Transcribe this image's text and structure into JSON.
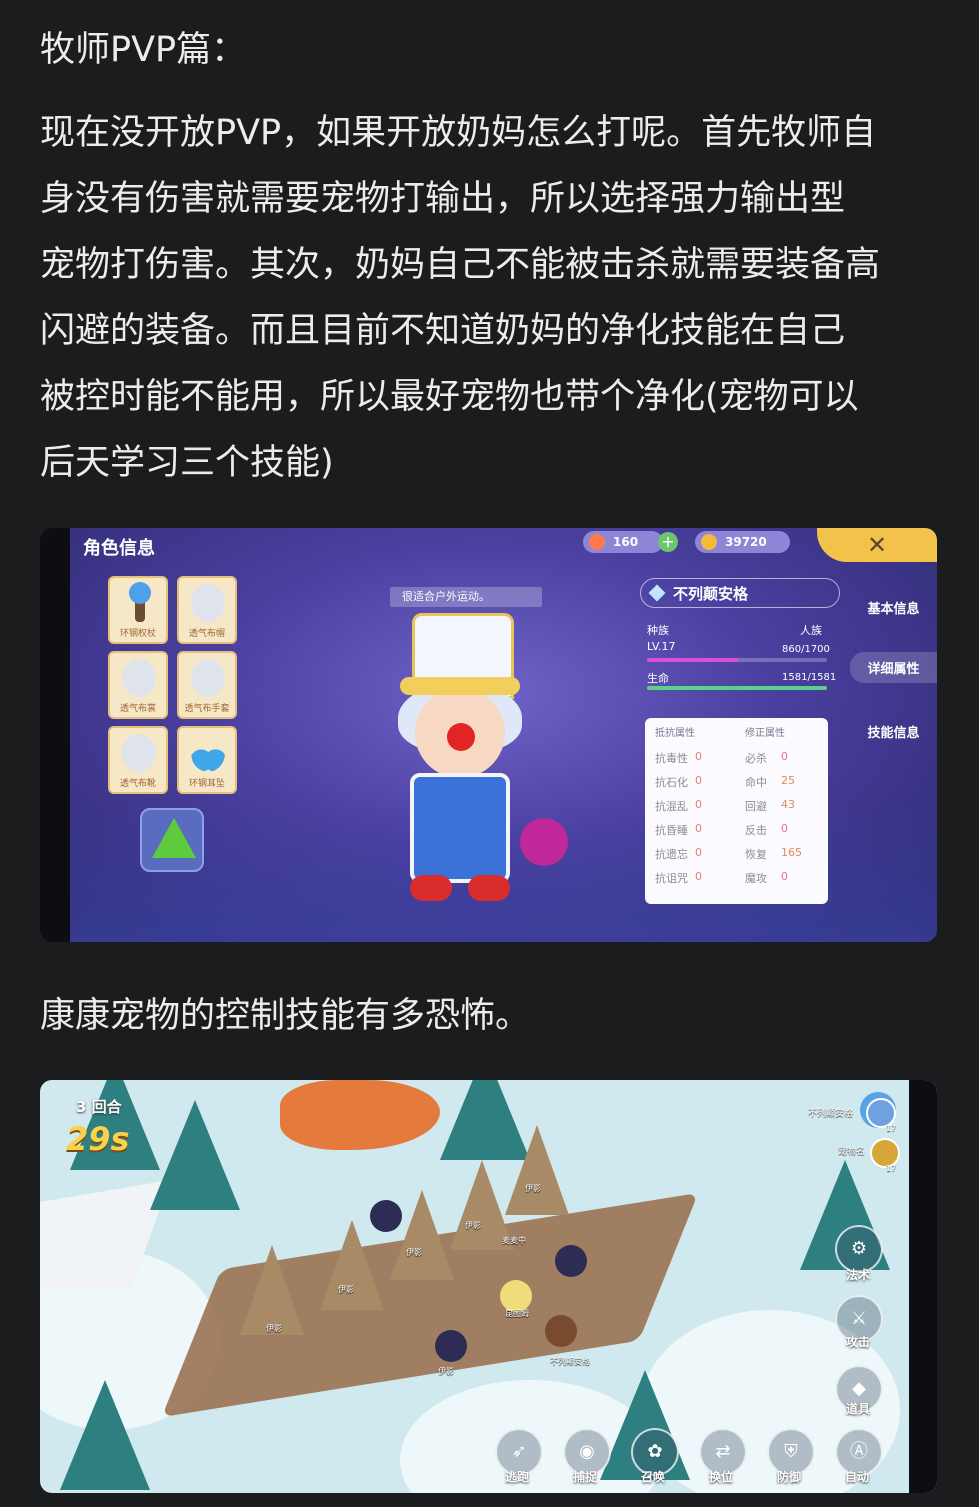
{
  "post": {
    "heading": "牧师PVP篇：",
    "paragraph_lines": [
      "现在没开放PVP，如果开放奶妈怎么打呢。首先牧师自",
      "身没有伤害就需要宠物打输出，所以选择强力输出型",
      "宠物打伤害。其次，奶妈自己不能被击杀就需要装备高",
      "闪避的装备。而且目前不知道奶妈的净化技能在自己",
      "被控时能不能用，所以最好宠物也带个净化(宠物可以",
      "后天学习三个技能)"
    ],
    "caption": "康康宠物的控制技能有多恐怖。"
  },
  "shot1": {
    "title": "角色信息",
    "currency1": "160",
    "currency2": "39720",
    "plus": "+",
    "close": "✕",
    "equipment": [
      "环钢权杖",
      "透气布帽",
      "透气布裳",
      "透气布手套",
      "透气布靴",
      "环钢耳坠"
    ],
    "tooltip": "很适合户外运动。",
    "name": "不列颠安格",
    "race_label": "种族",
    "race_value": "人族",
    "level": "LV.17",
    "exp": "860/1700",
    "exp_fraction": 0.506,
    "hp_label": "生命",
    "hp": "1581/1581",
    "hp_fraction": 1.0,
    "tabs": [
      "基本信息",
      "详细属性",
      "技能信息"
    ],
    "resist_header": "抵抗属性",
    "fix_header": "修正属性",
    "resist": [
      {
        "name": "抗毒性",
        "value": "0"
      },
      {
        "name": "抗石化",
        "value": "0"
      },
      {
        "name": "抗混乱",
        "value": "0"
      },
      {
        "name": "抗昏睡",
        "value": "0"
      },
      {
        "name": "抗遗忘",
        "value": "0"
      },
      {
        "name": "抗诅咒",
        "value": "0"
      }
    ],
    "fix": [
      {
        "name": "必杀",
        "value": "0"
      },
      {
        "name": "命中",
        "value": "25"
      },
      {
        "name": "回避",
        "value": "43"
      },
      {
        "name": "反击",
        "value": "0"
      },
      {
        "name": "恢复",
        "value": "165"
      },
      {
        "name": "魔攻",
        "value": "0"
      }
    ],
    "colors": {
      "exp_bar": "#d94fd6",
      "hp_bar": "#5fd08a",
      "accent": "#f2c24a"
    }
  },
  "shot2": {
    "round": "3 回合",
    "timer": "29s",
    "player_name": "不列颠安格",
    "player_level": "17",
    "pet_name": "宠物名",
    "pet_level": "17",
    "unit_labels": [
      "伊影",
      "伊影",
      "伊影",
      "伊影",
      "伊影",
      "伊影",
      "麦麦中",
      "昆图姆",
      "不列颠安格"
    ],
    "skills": [
      {
        "icon": "gear-icon",
        "label": "法术"
      },
      {
        "icon": "sword-icon",
        "label": "攻击"
      },
      {
        "icon": "bag-icon",
        "label": "道具"
      },
      {
        "icon": "flee-icon",
        "label": "逃跑"
      },
      {
        "icon": "camera-icon",
        "label": "捕捉"
      },
      {
        "icon": "summon-icon",
        "label": "召唤"
      },
      {
        "icon": "swap-icon",
        "label": "换位"
      },
      {
        "icon": "shield-icon",
        "label": "防御"
      },
      {
        "icon": "auto-icon",
        "label": "自动"
      }
    ]
  }
}
